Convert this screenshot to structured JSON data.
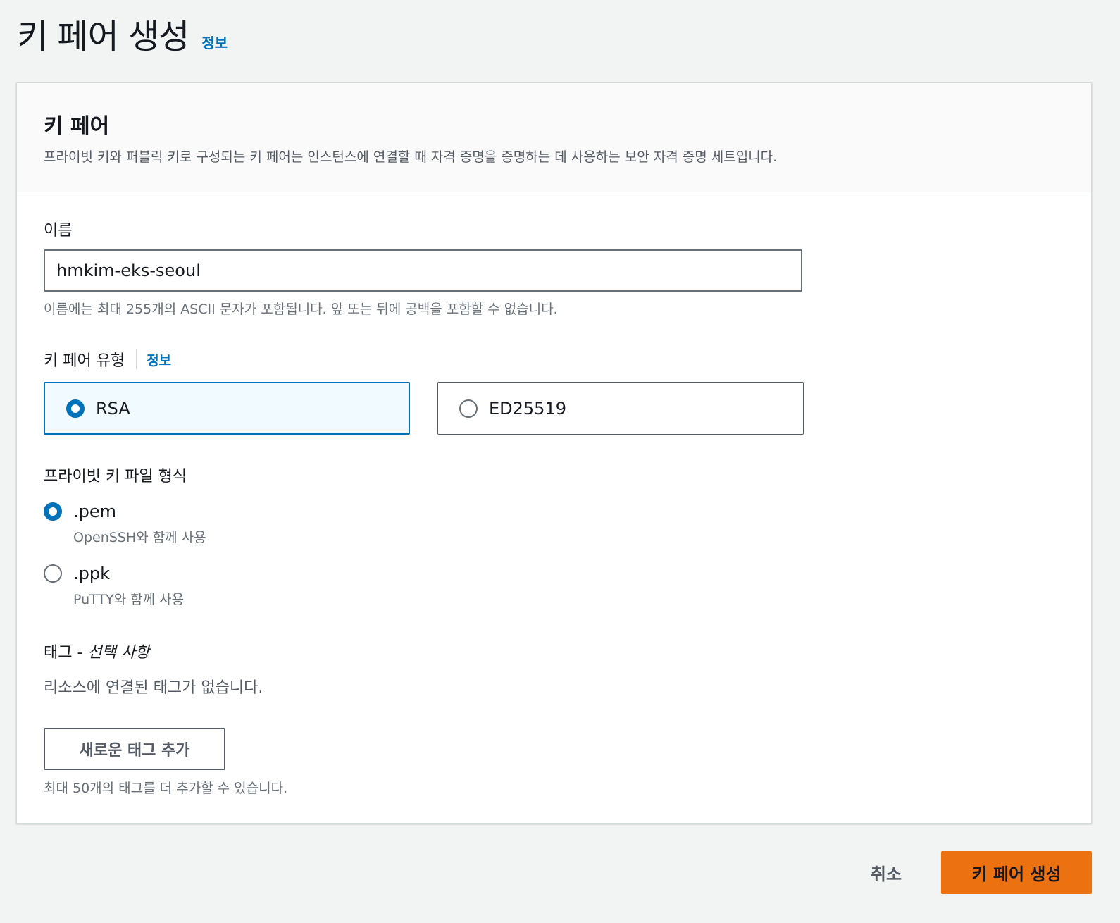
{
  "header": {
    "title": "키 페어 생성",
    "info_link": "정보"
  },
  "panel": {
    "title": "키 페어",
    "description": "프라이빗 키와 퍼블릭 키로 구성되는 키 페어는 인스턴스에 연결할 때 자격 증명을 증명하는 데 사용하는 보안 자격 증명 세트입니다."
  },
  "name": {
    "label": "이름",
    "value": "hmkim-eks-seoul",
    "hint": "이름에는 최대 255개의 ASCII 문자가 포함됩니다. 앞 또는 뒤에 공백을 포함할 수 없습니다."
  },
  "key_type": {
    "label": "키 페어 유형",
    "info_link": "정보",
    "options": [
      {
        "label": "RSA",
        "selected": true
      },
      {
        "label": "ED25519",
        "selected": false
      }
    ]
  },
  "file_format": {
    "label": "프라이빗 키 파일 형식",
    "options": [
      {
        "label": ".pem",
        "description": "OpenSSH와 함께 사용",
        "selected": true
      },
      {
        "label": ".ppk",
        "description": "PuTTY와 함께 사용",
        "selected": false
      }
    ]
  },
  "tags": {
    "label_main": "태그 - ",
    "label_optional": "선택 사항",
    "empty_text": "리소스에 연결된 태그가 없습니다.",
    "add_button": "새로운 태그 추가",
    "limit_text": "최대 50개의 태그를 더 추가할 수 있습니다."
  },
  "footer": {
    "cancel": "취소",
    "submit": "키 페어 생성"
  },
  "colors": {
    "accent": "#0073bb",
    "primary_button": "#ec7211",
    "background": "#f2f3f3"
  }
}
